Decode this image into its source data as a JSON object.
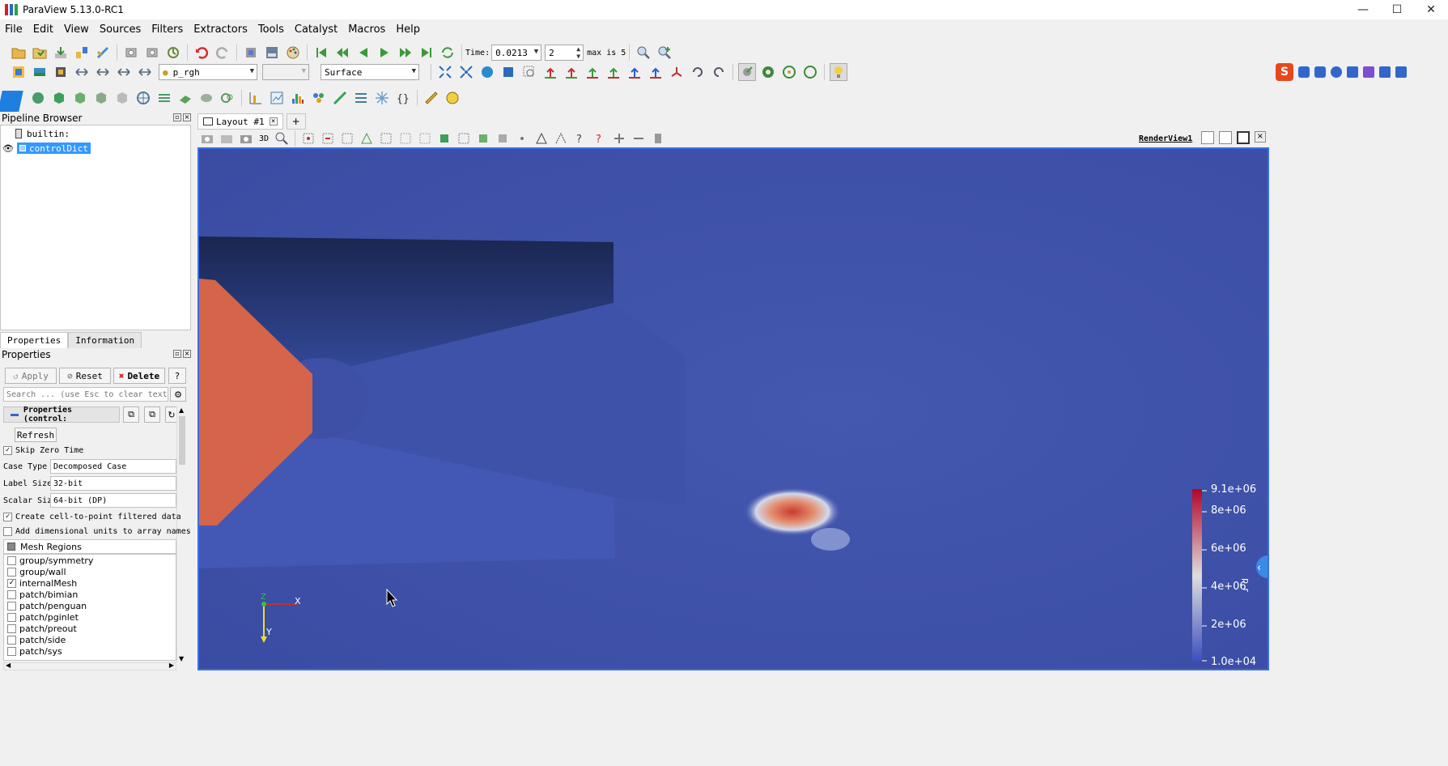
{
  "app": {
    "title": "ParaView 5.13.0-RC1"
  },
  "window_controls": {
    "minimize": "—",
    "maximize": "☐",
    "close": "✕"
  },
  "menu": [
    "File",
    "Edit",
    "View",
    "Sources",
    "Filters",
    "Extractors",
    "Tools",
    "Catalyst",
    "Macros",
    "Help"
  ],
  "time": {
    "label": "Time:",
    "value": "0.0213",
    "step": "2",
    "max_text": "max is 5"
  },
  "toolbar2": {
    "variable": "p_rgh",
    "component": "",
    "representation": "Surface"
  },
  "pipeline": {
    "title": "Pipeline Browser",
    "items": [
      {
        "label": "builtin:"
      },
      {
        "label": "controlDict"
      }
    ]
  },
  "tabs": {
    "properties": "Properties",
    "information": "Information"
  },
  "properties": {
    "title": "Properties",
    "apply": "Apply",
    "reset": "Reset",
    "delete": "Delete",
    "help": "?",
    "search_placeholder": "Search ... (use Esc to clear text)",
    "section": "Properties (control:",
    "refresh": "Refresh",
    "skip_zero_time": "Skip Zero Time",
    "case_type_label": "Case Type",
    "case_type_value": "Decomposed Case",
    "label_size_label": "Label Size",
    "label_size_value": "32-bit",
    "scalar_size_label": "Scalar Size",
    "scalar_size_value": "64-bit (DP)",
    "create_cell_to_point": "Create cell-to-point filtered data",
    "add_dimensional_units": "Add dimensional units to array names",
    "mesh_regions_label": "Mesh Regions",
    "mesh_regions": [
      {
        "name": "group/symmetry",
        "checked": false
      },
      {
        "name": "group/wall",
        "checked": false
      },
      {
        "name": "internalMesh",
        "checked": true
      },
      {
        "name": "patch/bimian",
        "checked": false
      },
      {
        "name": "patch/penguan",
        "checked": false
      },
      {
        "name": "patch/pginlet",
        "checked": false
      },
      {
        "name": "patch/preout",
        "checked": false
      },
      {
        "name": "patch/side",
        "checked": false
      },
      {
        "name": "patch/sys",
        "checked": false
      }
    ]
  },
  "layout": {
    "tab": "Layout #1",
    "add": "+",
    "render_view": "RenderView1",
    "mode_3d": "3D"
  },
  "axes": {
    "z": "Z",
    "x": "X",
    "y": "Y"
  },
  "colorbar": {
    "labels": [
      "9.1e+06",
      "8e+06",
      "6e+06",
      "4e+06",
      "2e+06",
      "1.0e+04"
    ],
    "title": "p_r",
    "colors": {
      "top": "#b40426",
      "mid": "#dddddd",
      "bottom": "#3b4cc0"
    }
  },
  "colors": {
    "accent": "#3a6ee8",
    "selection": "#3399ff"
  }
}
